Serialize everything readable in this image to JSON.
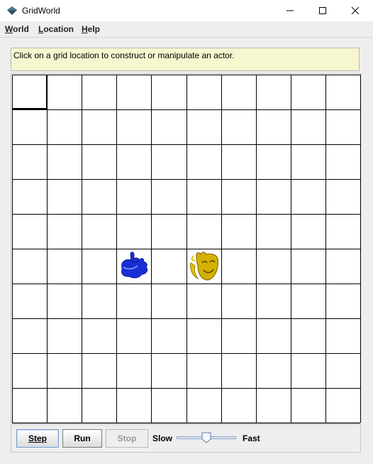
{
  "window": {
    "title": "GridWorld",
    "icon": "gridworld-diamond-icon",
    "controls": [
      "minimize-icon",
      "maximize-icon",
      "close-icon"
    ]
  },
  "menu": {
    "items": [
      {
        "label": "World",
        "mnemonic": "W"
      },
      {
        "label": "Location",
        "mnemonic": "L"
      },
      {
        "label": "Help",
        "mnemonic": "H"
      }
    ]
  },
  "message": "Click on a grid location to construct or manipulate an actor.",
  "grid": {
    "rows": 10,
    "cols": 10,
    "selected_cell": {
      "row": 0,
      "col": 0
    },
    "actors": [
      {
        "type": "blue-actor",
        "icon": "blue-blob-icon",
        "row": 5,
        "col": 3,
        "color": "#1a2fd6"
      },
      {
        "type": "gold-actor",
        "icon": "gold-mask-icon",
        "row": 5,
        "col": 5,
        "color": "#d4b000"
      }
    ]
  },
  "controls": {
    "step_label": "Step",
    "run_label": "Run",
    "stop_label": "Stop",
    "slow_label": "Slow",
    "fast_label": "Fast",
    "speed_fraction": 0.5
  },
  "colors": {
    "message_bg": "#f6f6cf",
    "grid_line": "#000000",
    "window_bg": "#eeeeee"
  }
}
